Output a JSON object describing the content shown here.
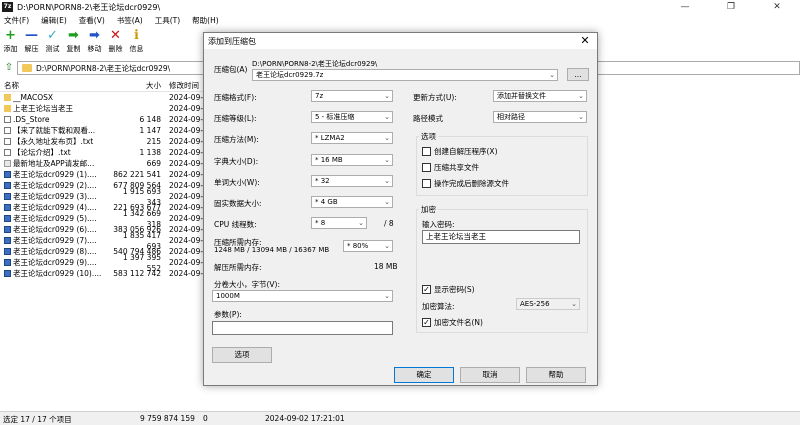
{
  "window": {
    "title": "D:\\PORN\\PORN8-2\\老王论坛dcr0929\\",
    "icon": "7z",
    "minimize": "—",
    "maximize": "❐",
    "close": "✕"
  },
  "menu": [
    "文件(F)",
    "编辑(E)",
    "查看(V)",
    "书签(A)",
    "工具(T)",
    "帮助(H)"
  ],
  "toolbar": [
    {
      "label": "添加",
      "icon": "add-icon",
      "glyph": "+",
      "color": "#1e9e1e"
    },
    {
      "label": "解压",
      "icon": "extract-icon",
      "glyph": "—",
      "color": "#2255cc"
    },
    {
      "label": "测试",
      "icon": "test-icon",
      "glyph": "✓",
      "color": "#33aacc"
    },
    {
      "label": "复制",
      "icon": "copy-icon",
      "glyph": "➡",
      "color": "#1e9e1e"
    },
    {
      "label": "移动",
      "icon": "move-icon",
      "glyph": "➡",
      "color": "#2255cc"
    },
    {
      "label": "删除",
      "icon": "delete-icon",
      "glyph": "✕",
      "color": "#cc1111"
    },
    {
      "label": "信息",
      "icon": "info-icon",
      "glyph": "ℹ",
      "color": "#cc9900"
    }
  ],
  "address": "D:\\PORN\\PORN8-2\\老王论坛dcr0929\\",
  "filelist": {
    "headers": {
      "name": "名称",
      "size": "大小",
      "date": "修改时间"
    },
    "rows": [
      {
        "name": "__MACOSX",
        "size": "",
        "date": "2024-09-0",
        "type": "folder"
      },
      {
        "name": "上老王论坛当老王",
        "size": "",
        "date": "2024-09-0",
        "type": "folder"
      },
      {
        "name": ".DS_Store",
        "size": "6 148",
        "date": "2024-09-0",
        "type": "doc"
      },
      {
        "name": "【来了就能下载和观看...",
        "size": "1 147",
        "date": "2024-09-0",
        "type": "doc"
      },
      {
        "name": "【永久地址发布页】.txt",
        "size": "215",
        "date": "2024-09-0",
        "type": "doc"
      },
      {
        "name": "【论坛介绍】.txt",
        "size": "1 138",
        "date": "2024-09-0",
        "type": "doc"
      },
      {
        "name": "最新地址及APP请发邮...",
        "size": "669",
        "date": "2024-09-0",
        "type": "html"
      },
      {
        "name": "老王论坛dcr0929 (1)....",
        "size": "862 221 541",
        "date": "2024-09-0",
        "type": "arc"
      },
      {
        "name": "老王论坛dcr0929 (2)....",
        "size": "677 809 564",
        "date": "2024-09-0",
        "type": "arc"
      },
      {
        "name": "老王论坛dcr0929 (3)....",
        "size": "1 915 693 343",
        "date": "2024-09-0",
        "type": "arc"
      },
      {
        "name": "老王论坛dcr0929 (4)....",
        "size": "221 693 677",
        "date": "2024-09-0",
        "type": "arc"
      },
      {
        "name": "老王论坛dcr0929 (5)....",
        "size": "1 342 669 318",
        "date": "2024-09-0",
        "type": "arc"
      },
      {
        "name": "老王论坛dcr0929 (6)....",
        "size": "383 056 926",
        "date": "2024-09-0",
        "type": "arc"
      },
      {
        "name": "老王论坛dcr0929 (7)....",
        "size": "1 835 417 693",
        "date": "2024-09-0",
        "type": "arc"
      },
      {
        "name": "老王论坛dcr0929 (8)....",
        "size": "540 794 486",
        "date": "2024-09-0",
        "type": "arc"
      },
      {
        "name": "老王论坛dcr0929 (9)....",
        "size": "1 397 395 552",
        "date": "2024-09-0",
        "type": "arc"
      },
      {
        "name": "老王论坛dcr0929 (10)....",
        "size": "583 112 742",
        "date": "2024-09-0",
        "type": "arc"
      }
    ]
  },
  "status": {
    "selected": "选定 17 / 17 个项目",
    "total_size": "9 759 874 159",
    "packed": "0",
    "modified": "2024-09-02 17:21:01"
  },
  "dialog": {
    "title": "添加到压缩包",
    "close": "✕",
    "archive_label": "压缩包(A)",
    "archive_path": "D:\\PORN\\PORN8-2\\老王论坛dcr0929\\",
    "archive_name": "老王论坛dcr0929.7z",
    "browse": "...",
    "format_label": "压缩格式(F):",
    "format_value": "7z",
    "level_label": "压缩等级(L):",
    "level_value": "5 - 标准压缩",
    "method_label": "压缩方法(M):",
    "method_value": "* LZMA2",
    "dict_label": "字典大小(D):",
    "dict_value": "* 16 MB",
    "word_label": "单词大小(W):",
    "word_value": "* 32",
    "solid_label": "固实数据大小:",
    "solid_value": "* 4 GB",
    "threads_label": "CPU 线程数:",
    "threads_value": "* 8",
    "threads_max": "/ 8",
    "mem_label": "压缩所需内存:",
    "mem_detail": "1248 MB / 13094 MB / 16367 MB",
    "mem_percent": "* 80%",
    "decomp_label": "解压所需内存:",
    "decomp_value": "18 MB",
    "split_label": "分卷大小，字节(V):",
    "split_value": "1000M",
    "params_label": "参数(P):",
    "params_value": "",
    "options_button": "选项",
    "update_label": "更新方式(U):",
    "update_value": "添加并替换文件",
    "path_label": "路径模式",
    "path_value": "相对路径",
    "options_group": "选项",
    "opt_sfx": "创建自解压程序(X)",
    "opt_shared": "压缩共享文件",
    "opt_delete": "操作完成后删除源文件",
    "encrypt_group": "加密",
    "password_label": "输入密码:",
    "password_value": "上老王论坛当老王",
    "show_password": "显示密码(S)",
    "enc_method_label": "加密算法:",
    "enc_method_value": "AES-256",
    "encrypt_names": "加密文件名(N)",
    "ok": "确定",
    "cancel": "取消",
    "help": "帮助"
  }
}
